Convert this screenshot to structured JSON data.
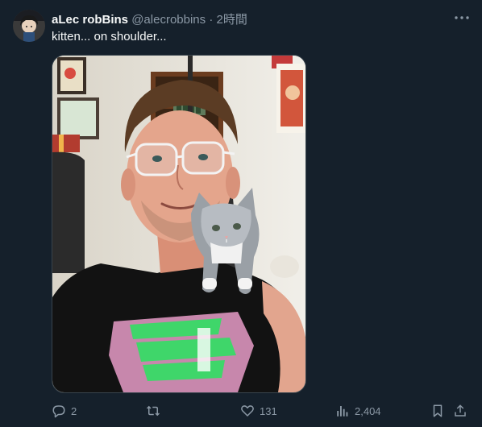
{
  "tweet": {
    "author_name": "aLec robBins",
    "handle": "@alecrobbins",
    "separator": "·",
    "time": "2時間",
    "text": "kitten... on shoulder..."
  },
  "actions": {
    "replies": "2",
    "reposts": "",
    "likes": "131",
    "views": "2,404"
  },
  "icons": {
    "more": "more-dots-icon",
    "reply": "reply-icon",
    "repost": "repost-icon",
    "like": "heart-icon",
    "views": "analytics-icon",
    "bookmark": "bookmark-icon",
    "share": "share-icon"
  },
  "colors": {
    "background": "#15202b",
    "primary_text": "#f7f9f9",
    "secondary_text": "#8b98a5",
    "border": "#38444d",
    "shirt_print": "#3fd66a"
  }
}
